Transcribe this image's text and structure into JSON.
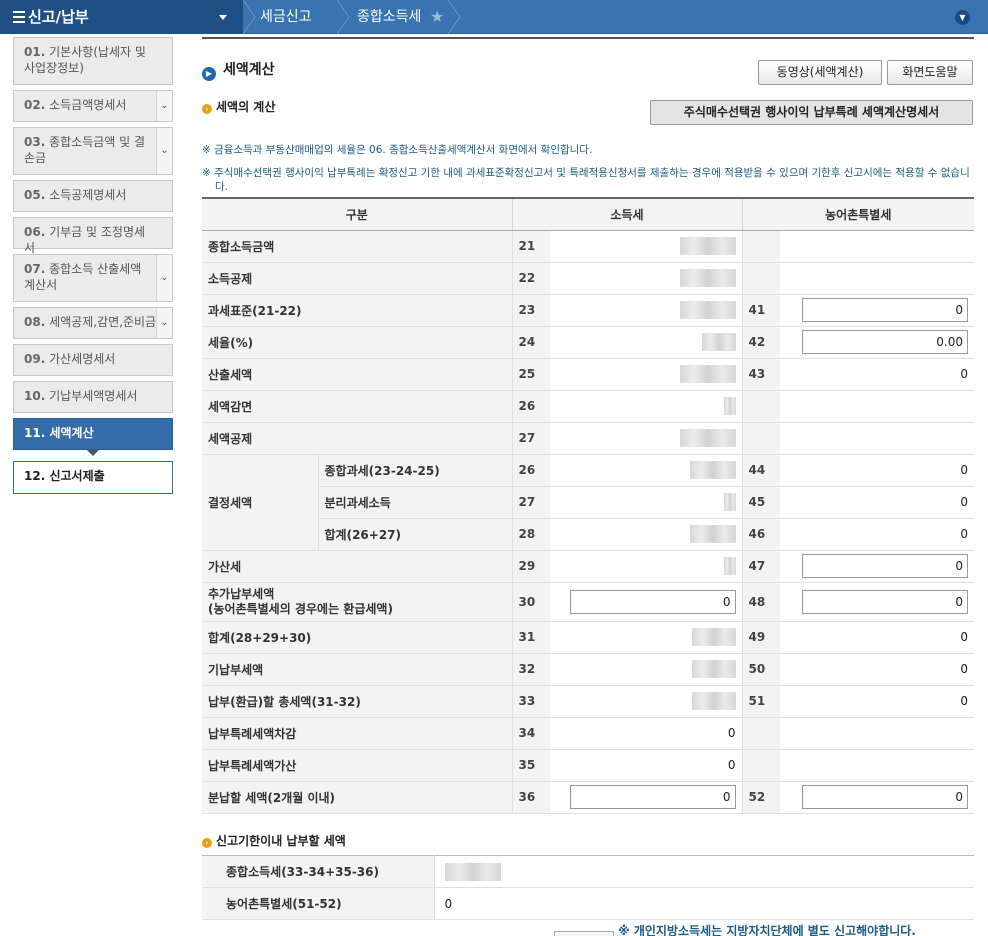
{
  "topbar": {
    "menu_label": "신고/납부",
    "crumbs": [
      "세금신고",
      "종합소득세"
    ]
  },
  "sidebar": {
    "items": [
      {
        "no": "01.",
        "label": "기본사항(납세자 및 사업장정보)",
        "dropdown": false
      },
      {
        "no": "02.",
        "label": "소득금액명세서",
        "dropdown": true
      },
      {
        "no": "03.",
        "label": "종합소득금액 및 결손금",
        "dropdown": true
      },
      {
        "no": "05.",
        "label": "소득공제명세서",
        "dropdown": false
      },
      {
        "no": "06.",
        "label": "기부금 및 조정명세서",
        "dropdown": false
      },
      {
        "no": "07.",
        "label": "종합소득 산출세액계산서",
        "dropdown": true
      },
      {
        "no": "08.",
        "label": "세액공제,감면,준비금",
        "dropdown": true
      },
      {
        "no": "09.",
        "label": "가산세명세서",
        "dropdown": false
      },
      {
        "no": "10.",
        "label": "기납부세액명세서",
        "dropdown": false
      },
      {
        "no": "11.",
        "label": "세액계산",
        "dropdown": false,
        "active": true
      },
      {
        "no": "12.",
        "label": "신고서제출",
        "dropdown": false,
        "next": true
      }
    ]
  },
  "main": {
    "title": "세액계산",
    "btn_video": "동영상(세액계산)",
    "btn_help": "화면도움말",
    "section1": "세액의 계산",
    "btn_stock": "주식매수선택권 행사이익 납부특례 세액계산명세서",
    "note1": "※ 금융소득과 부동산매매업의 세율은 06. 종합소득산출세액계산서 화면에서 확인합니다.",
    "note2": "※ 주식매수선택권 행사이익 납부특례는 확정신고 기한 내에 과세표준확정신고서 및 특례적용신청서를 제출하는 경우에 적용받을 수 있으며 기한후 신고시에는 적용할 수 없습니다.",
    "table": {
      "headers": [
        "구분",
        "소득세",
        "농어촌특별세"
      ],
      "rows": {
        "r21": {
          "label": "종합소득금액",
          "no": "21"
        },
        "r22": {
          "label": "소득공제",
          "no": "22"
        },
        "r23": {
          "label": "과세표준(21-22)",
          "no": "23",
          "no2": "41",
          "v2": "0"
        },
        "r24": {
          "label": "세율(%)",
          "no": "24",
          "no2": "42",
          "v2": "0.00"
        },
        "r25": {
          "label": "산출세액",
          "no": "25",
          "no2": "43",
          "v2": "0"
        },
        "r26a": {
          "label": "세액감면",
          "no": "26"
        },
        "r27a": {
          "label": "세액공제",
          "no": "27"
        },
        "group": "결정세액",
        "r26b": {
          "label": "종합과세(23-24-25)",
          "no": "26",
          "no2": "44",
          "v2": "0"
        },
        "r27b": {
          "label": "분리과세소득",
          "no": "27",
          "no2": "45",
          "v2": "0"
        },
        "r28": {
          "label": "합계(26+27)",
          "no": "28",
          "no2": "46",
          "v2": "0"
        },
        "r29": {
          "label": "가산세",
          "no": "29",
          "no2": "47",
          "v2": "0"
        },
        "r30": {
          "label": "추가납부세액",
          "label2": "(농어촌특별세의 경우에는 환급세액)",
          "no": "30",
          "v1": "0",
          "no2": "48",
          "v2": "0"
        },
        "r31": {
          "label": "합계(28+29+30)",
          "no": "31",
          "no2": "49",
          "v2": "0"
        },
        "r32": {
          "label": "기납부세액",
          "no": "32",
          "no2": "50",
          "v2": "0"
        },
        "r33": {
          "label": "납부(환급)할 총세액(31-32)",
          "no": "33",
          "no2": "51",
          "v2": "0"
        },
        "r34": {
          "label": "납부특례세액차감",
          "no": "34",
          "v1": "0"
        },
        "r35": {
          "label": "납부특례세액가산",
          "no": "35",
          "v1": "0"
        },
        "r36": {
          "label": "분납할 세액(2개월 이내)",
          "no": "36",
          "v1": "0",
          "no2": "52",
          "v2": "0"
        }
      }
    },
    "section2": "신고기한이내 납부할 세액",
    "due": {
      "income_label": "종합소득세(33-34+35-36)",
      "rural_label": "농어촌특별세(51-52)",
      "rural_value": "0"
    },
    "bottom_note": "※ 개인지방소득세는 지방자치단체에 별도 신고해야합니다."
  }
}
